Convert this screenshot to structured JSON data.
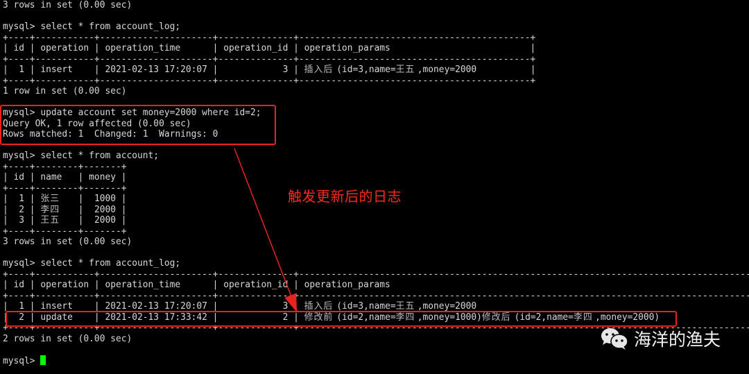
{
  "terminal": {
    "prompt": "mysql> ",
    "lines": [
      "3 rows in set (0.00 sec)",
      "",
      "mysql> select * from account_log;",
      "+----+-----------+---------------------+--------------+-------------------------------------------+",
      "| id | operation | operation_time      | operation_id | operation_params                          |",
      "+----+-----------+---------------------+--------------+-------------------------------------------+",
      "|  1 | insert    | 2021-02-13 17:20:07 |            3 | 插入后(id=3,name=王五,money=2000          |",
      "+----+-----------+---------------------+--------------+-------------------------------------------+",
      "1 row in set (0.00 sec)",
      "",
      "mysql> update account set money=2000 where id=2;",
      "Query OK, 1 row affected (0.00 sec)",
      "Rows matched: 1  Changed: 1  Warnings: 0",
      "",
      "mysql> select * from account;",
      "+----+--------+-------+",
      "| id | name   | money |",
      "+----+--------+-------+",
      "|  1 | 张三   |  1000 |",
      "|  2 | 李四   |  2000 |",
      "|  3 | 王五   |  2000 |",
      "+----+--------+-------+",
      "3 rows in set (0.00 sec)",
      "",
      "mysql> select * from account_log;",
      "+----+-----------+---------------------+--------------+-------------------------------------------------------------------------------------+",
      "| id | operation | operation_time      | operation_id | operation_params                                                                    |",
      "+----+-----------+---------------------+--------------+-------------------------------------------------------------------------------------+",
      "|  1 | insert    | 2021-02-13 17:20:07 |            3 | 插入后(id=3,name=王五,money=2000                                                    |",
      "|  2 | update    | 2021-02-13 17:33:42 |            2 | 修改前(id=2,name=李四,money=1000)修改后(id=2,name=李四,money=2000)                  |",
      "+----+-----------+---------------------+--------------+-------------------------------------------------------------------------------------+",
      "2 rows in set (0.00 sec)",
      "",
      "mysql> "
    ]
  },
  "queries": {
    "account_log_first": {
      "command": "select * from account_log;",
      "columns": [
        "id",
        "operation",
        "operation_time",
        "operation_id",
        "operation_params"
      ],
      "rows": [
        [
          "1",
          "insert",
          "2021-02-13 17:20:07",
          "3",
          "插入后(id=3,name=王五,money=2000"
        ]
      ],
      "summary": "1 row in set (0.00 sec)"
    },
    "update": {
      "command": "update account set money=2000 where id=2;",
      "result": "Query OK, 1 row affected (0.00 sec)",
      "info": "Rows matched: 1  Changed: 1  Warnings: 0"
    },
    "account": {
      "command": "select * from account;",
      "columns": [
        "id",
        "name",
        "money"
      ],
      "rows": [
        [
          "1",
          "张三",
          "1000"
        ],
        [
          "2",
          "李四",
          "2000"
        ],
        [
          "3",
          "王五",
          "2000"
        ]
      ],
      "summary": "3 rows in set (0.00 sec)"
    },
    "account_log_second": {
      "command": "select * from account_log;",
      "columns": [
        "id",
        "operation",
        "operation_time",
        "operation_id",
        "operation_params"
      ],
      "rows": [
        [
          "1",
          "insert",
          "2021-02-13 17:20:07",
          "3",
          "插入后(id=3,name=王五,money=2000"
        ],
        [
          "2",
          "update",
          "2021-02-13 17:33:42",
          "2",
          "修改前(id=2,name=李四,money=1000)修改后(id=2,name=李四,money=2000)"
        ]
      ],
      "summary": "2 rows in set (0.00 sec)"
    }
  },
  "annotation": {
    "label": "触发更新后的日志",
    "color": "#e8231d"
  },
  "cursor_color": "#00ff00",
  "watermark": {
    "icon": "wechat-icon",
    "text": "海洋的渔夫"
  }
}
